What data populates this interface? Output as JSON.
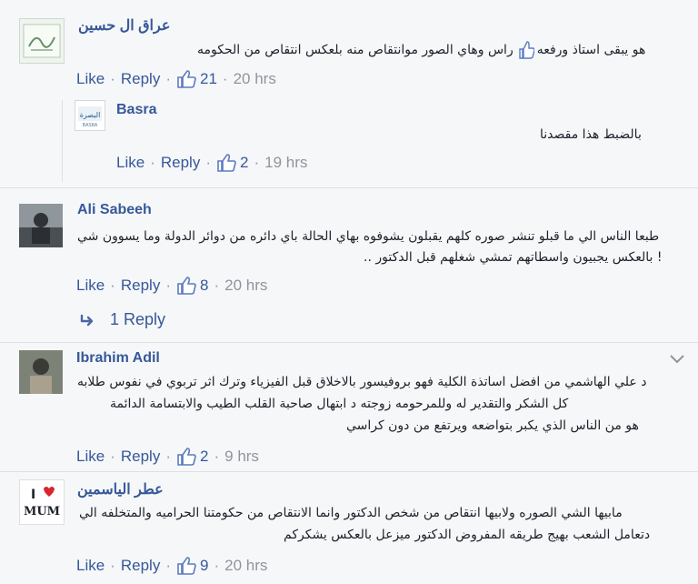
{
  "labels": {
    "like": "Like",
    "reply": "Reply",
    "dot": "·"
  },
  "comments": [
    {
      "author": "عراق ال حسين",
      "avatar_text": "الحمد لله",
      "lines": [
        "هو يبقى استاذ ورفعه",
        "راس وهاي الصور موانتقاص منه بلعكس انتقاص من الحكومه"
      ],
      "likes": "21",
      "time": "20 hrs"
    },
    {
      "author": "Basra",
      "avatar_text": "البصرة",
      "avatar_sub": "BASRA",
      "lines": [
        "بالضبط هذا مقصدنا"
      ],
      "likes": "2",
      "time": "19 hrs"
    },
    {
      "author": "Ali Sabeeh",
      "lines": [
        "طبعا الناس الي ما قبلو تنشر صوره كلهم يقبلون يشوفوه بهاي الحالة باي دائره من دوائر الدولة وما يسوون شي",
        "! بالعكس يجبيون واسطاتهم تمشي شغلهم قبل الدكتور .."
      ],
      "likes": "8",
      "time": "20 hrs",
      "replies_label": "1 Reply"
    },
    {
      "author": "Ibrahim Adil",
      "lines": [
        "د علي الهاشمي من افضل اساتذة الكلية فهو بروفيسور بالاخلاق قبل الفيزياء وترك اثر تربوي في نفوس طلابه",
        "كل الشكر والتقدير له وللمرحومه زوجته د ابتهال صاحبة القلب الطيب والابتسامة الدائمة",
        "هو من الناس الذي يكبر بتواضعه ويرتفع من دون كراسي"
      ],
      "likes": "2",
      "time": "9 hrs"
    },
    {
      "author": "عطر الياسمين",
      "avatar_text_1": "I",
      "avatar_text_2": "MUM",
      "lines": [
        "مابيها الشي الصوره ولابيها انتقاص من شخص الدكتور وانما الانتقاص من حكومتنا الحراميه والمتخلفه الي",
        "دتعامل الشعب بهيج طريقه المفروض الدكتور ميزعل بالعكس يشكركم"
      ],
      "likes": "9",
      "time": "20 hrs"
    }
  ]
}
